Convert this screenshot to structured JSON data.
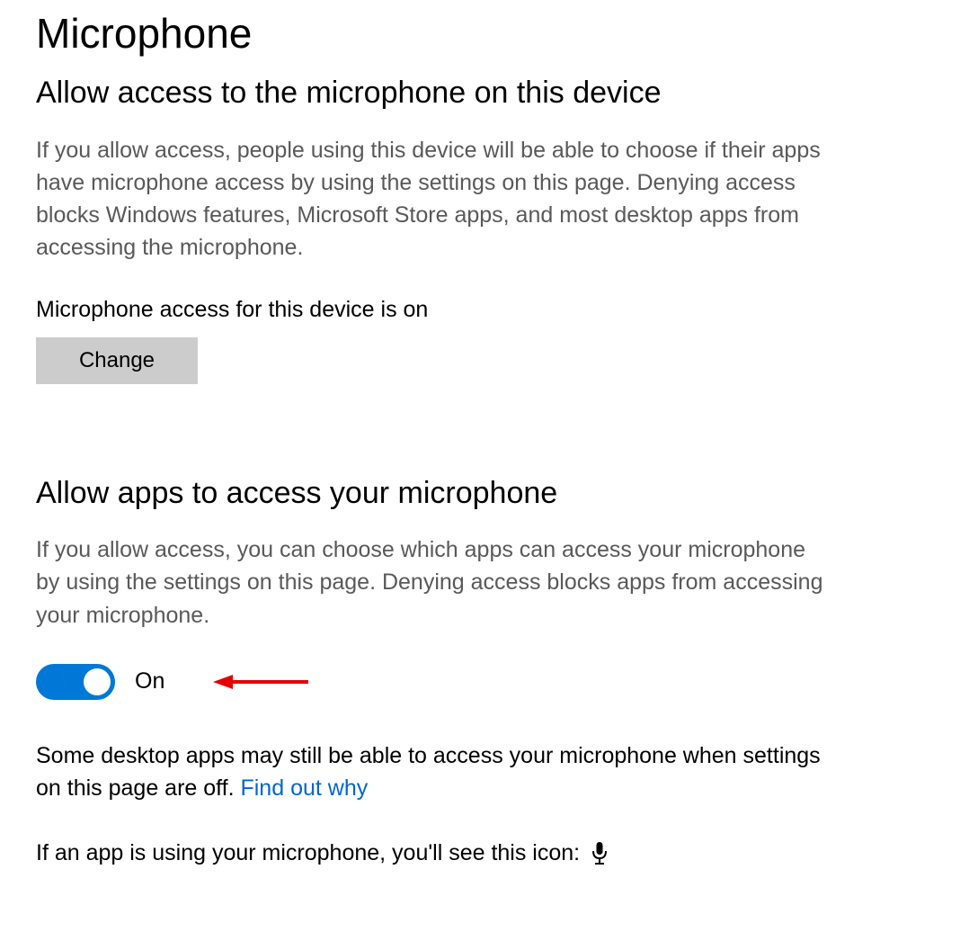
{
  "page": {
    "title": "Microphone"
  },
  "section1": {
    "heading": "Allow access to the microphone on this device",
    "description": "If you allow access, people using this device will be able to choose if their apps have microphone access by using the settings on this page. Denying access blocks Windows features, Microsoft Store apps, and most desktop apps from accessing the microphone.",
    "status": "Microphone access for this device is on",
    "change_button": "Change"
  },
  "section2": {
    "heading": "Allow apps to access your microphone",
    "description": "If you allow access, you can choose which apps can access your microphone by using the settings on this page. Denying access blocks apps from accessing your microphone.",
    "toggle_state": "On",
    "desktop_note_1": "Some desktop apps may still be able to access your microphone when settings on this page are off. ",
    "desktop_note_link": "Find out why",
    "icon_note": "If an app is using your microphone, you'll see this icon:"
  }
}
